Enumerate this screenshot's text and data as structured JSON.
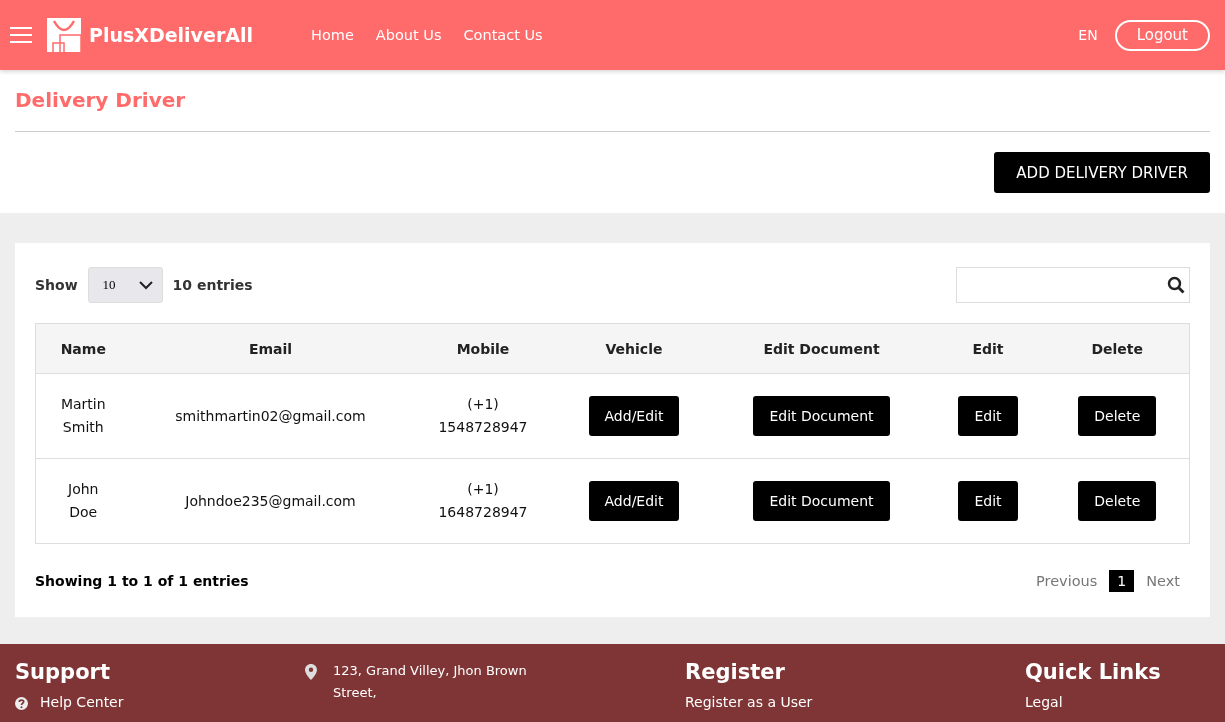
{
  "header": {
    "brand": "PlusXDeliverAll",
    "nav": [
      "Home",
      "About Us",
      "Contact Us"
    ],
    "language": "EN",
    "logout": "Logout"
  },
  "page": {
    "title": "Delivery Driver",
    "add_button": "ADD DELIVERY DRIVER"
  },
  "table_controls": {
    "show_label": "Show",
    "page_size": "10",
    "entries_label": "10 entries"
  },
  "table": {
    "columns": [
      "Name",
      "Email",
      "Mobile",
      "Vehicle",
      "Edit Document",
      "Edit",
      "Delete"
    ],
    "rows": [
      {
        "name": "Martin Smith",
        "email": "smithmartin02@gmail.com",
        "mobile_code": "(+1)",
        "mobile": "1548728947",
        "vehicle": "Add/Edit",
        "document": "Edit Document",
        "edit": "Edit",
        "delete": "Delete"
      },
      {
        "name": "John Doe",
        "email": "Johndoe235@gmail.com",
        "mobile_code": "(+1)",
        "mobile": "1648728947",
        "vehicle": "Add/Edit",
        "document": "Edit Document",
        "edit": "Edit",
        "delete": "Delete"
      }
    ]
  },
  "table_info": "Showing 1 to 1 of 1 entries",
  "pagination": [
    {
      "label": "Previous",
      "kind": "nav",
      "selected": false
    },
    {
      "label": "1",
      "kind": "page",
      "selected": true
    },
    {
      "label": "Next",
      "kind": "nav",
      "selected": false
    }
  ],
  "footer": {
    "columns": [
      {
        "heading": "Support",
        "items": [
          {
            "kind": "help",
            "text": "Help Center"
          }
        ]
      },
      {
        "items": [
          {
            "kind": "address",
            "text": "123, Grand Villey, Jhon Brown Street,"
          }
        ]
      },
      {
        "heading": "Register",
        "items": [
          {
            "kind": "link",
            "text": "Register as a User"
          }
        ]
      },
      {
        "heading": "Quick Links",
        "items": [
          {
            "kind": "link",
            "text": "Legal"
          }
        ]
      }
    ]
  }
}
